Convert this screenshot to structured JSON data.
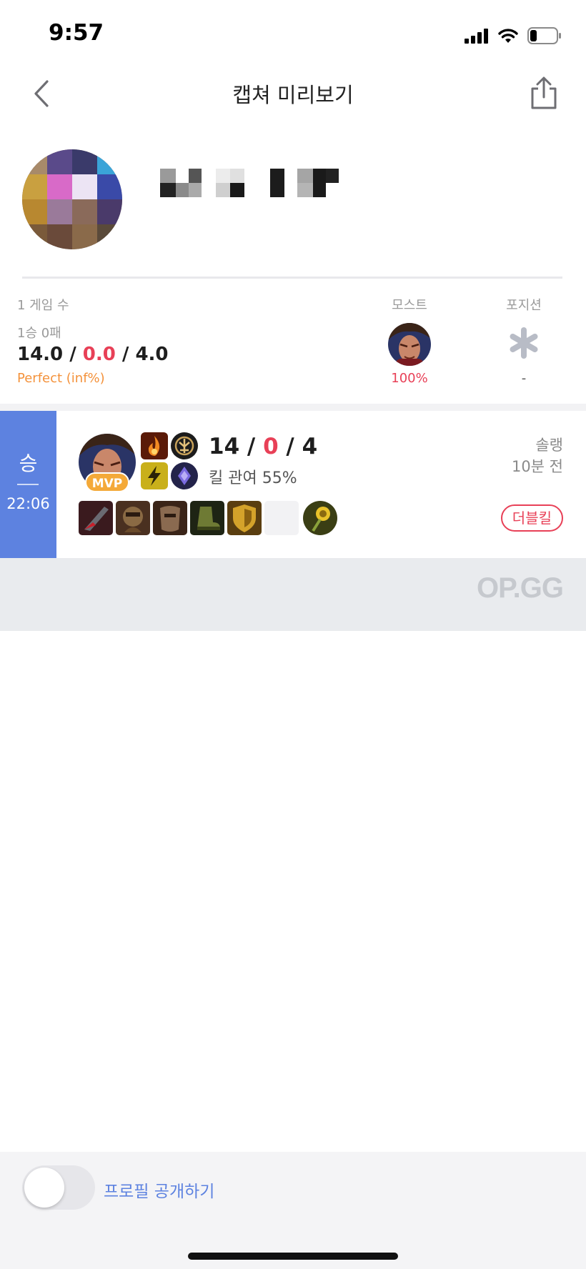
{
  "status_bar": {
    "time": "9:57"
  },
  "nav": {
    "title": "캡쳐 미리보기"
  },
  "summary": {
    "games_label": "1 게임 수",
    "win_loss": "1승 0패",
    "kda": {
      "kills": "14.0",
      "deaths": "0.0",
      "assists": "4.0",
      "sep": " / "
    },
    "kda_ratio": "Perfect (inf%)",
    "most_label": "모스트",
    "most_winrate": "100%",
    "position_label": "포지션",
    "position_value": "-"
  },
  "match": {
    "result": "승",
    "duration": "22:06",
    "mvp_badge": "MVP",
    "kda": {
      "kills": "14",
      "deaths": "0",
      "assists": "4",
      "sep": " / "
    },
    "kill_participation": "킬 관여 55%",
    "queue": "솔랭",
    "time_ago": "10분 전",
    "multikill": "더블킬"
  },
  "brand": {
    "logo": "OP.GG"
  },
  "bottom": {
    "toggle_label": "프로필 공개하기",
    "toggle_on": false
  },
  "colors": {
    "win": "#5d82e0",
    "loss_red": "#e84057",
    "perfect": "#f4923b",
    "mvp": "#f4a938"
  }
}
